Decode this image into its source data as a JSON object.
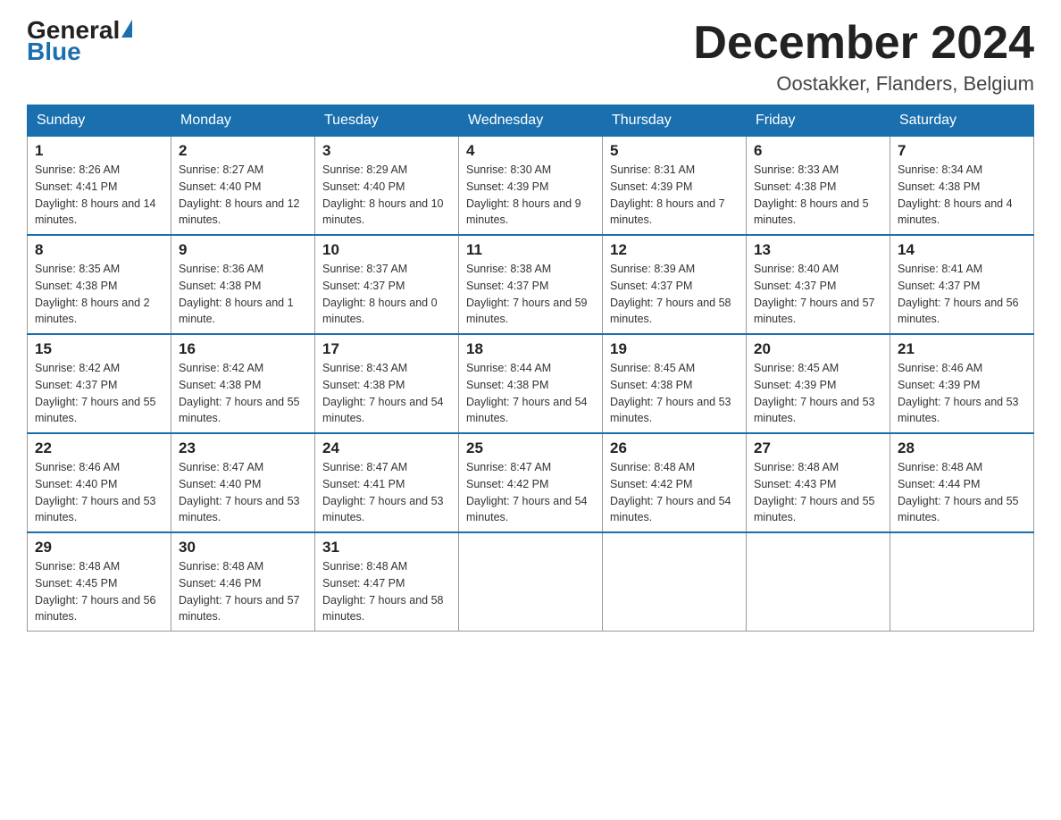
{
  "logo": {
    "general": "General",
    "blue": "Blue"
  },
  "header": {
    "title": "December 2024",
    "subtitle": "Oostakker, Flanders, Belgium"
  },
  "columns": [
    "Sunday",
    "Monday",
    "Tuesday",
    "Wednesday",
    "Thursday",
    "Friday",
    "Saturday"
  ],
  "weeks": [
    [
      {
        "day": "1",
        "sunrise": "8:26 AM",
        "sunset": "4:41 PM",
        "daylight": "8 hours and 14 minutes."
      },
      {
        "day": "2",
        "sunrise": "8:27 AM",
        "sunset": "4:40 PM",
        "daylight": "8 hours and 12 minutes."
      },
      {
        "day": "3",
        "sunrise": "8:29 AM",
        "sunset": "4:40 PM",
        "daylight": "8 hours and 10 minutes."
      },
      {
        "day": "4",
        "sunrise": "8:30 AM",
        "sunset": "4:39 PM",
        "daylight": "8 hours and 9 minutes."
      },
      {
        "day": "5",
        "sunrise": "8:31 AM",
        "sunset": "4:39 PM",
        "daylight": "8 hours and 7 minutes."
      },
      {
        "day": "6",
        "sunrise": "8:33 AM",
        "sunset": "4:38 PM",
        "daylight": "8 hours and 5 minutes."
      },
      {
        "day": "7",
        "sunrise": "8:34 AM",
        "sunset": "4:38 PM",
        "daylight": "8 hours and 4 minutes."
      }
    ],
    [
      {
        "day": "8",
        "sunrise": "8:35 AM",
        "sunset": "4:38 PM",
        "daylight": "8 hours and 2 minutes."
      },
      {
        "day": "9",
        "sunrise": "8:36 AM",
        "sunset": "4:38 PM",
        "daylight": "8 hours and 1 minute."
      },
      {
        "day": "10",
        "sunrise": "8:37 AM",
        "sunset": "4:37 PM",
        "daylight": "8 hours and 0 minutes."
      },
      {
        "day": "11",
        "sunrise": "8:38 AM",
        "sunset": "4:37 PM",
        "daylight": "7 hours and 59 minutes."
      },
      {
        "day": "12",
        "sunrise": "8:39 AM",
        "sunset": "4:37 PM",
        "daylight": "7 hours and 58 minutes."
      },
      {
        "day": "13",
        "sunrise": "8:40 AM",
        "sunset": "4:37 PM",
        "daylight": "7 hours and 57 minutes."
      },
      {
        "day": "14",
        "sunrise": "8:41 AM",
        "sunset": "4:37 PM",
        "daylight": "7 hours and 56 minutes."
      }
    ],
    [
      {
        "day": "15",
        "sunrise": "8:42 AM",
        "sunset": "4:37 PM",
        "daylight": "7 hours and 55 minutes."
      },
      {
        "day": "16",
        "sunrise": "8:42 AM",
        "sunset": "4:38 PM",
        "daylight": "7 hours and 55 minutes."
      },
      {
        "day": "17",
        "sunrise": "8:43 AM",
        "sunset": "4:38 PM",
        "daylight": "7 hours and 54 minutes."
      },
      {
        "day": "18",
        "sunrise": "8:44 AM",
        "sunset": "4:38 PM",
        "daylight": "7 hours and 54 minutes."
      },
      {
        "day": "19",
        "sunrise": "8:45 AM",
        "sunset": "4:38 PM",
        "daylight": "7 hours and 53 minutes."
      },
      {
        "day": "20",
        "sunrise": "8:45 AM",
        "sunset": "4:39 PM",
        "daylight": "7 hours and 53 minutes."
      },
      {
        "day": "21",
        "sunrise": "8:46 AM",
        "sunset": "4:39 PM",
        "daylight": "7 hours and 53 minutes."
      }
    ],
    [
      {
        "day": "22",
        "sunrise": "8:46 AM",
        "sunset": "4:40 PM",
        "daylight": "7 hours and 53 minutes."
      },
      {
        "day": "23",
        "sunrise": "8:47 AM",
        "sunset": "4:40 PM",
        "daylight": "7 hours and 53 minutes."
      },
      {
        "day": "24",
        "sunrise": "8:47 AM",
        "sunset": "4:41 PM",
        "daylight": "7 hours and 53 minutes."
      },
      {
        "day": "25",
        "sunrise": "8:47 AM",
        "sunset": "4:42 PM",
        "daylight": "7 hours and 54 minutes."
      },
      {
        "day": "26",
        "sunrise": "8:48 AM",
        "sunset": "4:42 PM",
        "daylight": "7 hours and 54 minutes."
      },
      {
        "day": "27",
        "sunrise": "8:48 AM",
        "sunset": "4:43 PM",
        "daylight": "7 hours and 55 minutes."
      },
      {
        "day": "28",
        "sunrise": "8:48 AM",
        "sunset": "4:44 PM",
        "daylight": "7 hours and 55 minutes."
      }
    ],
    [
      {
        "day": "29",
        "sunrise": "8:48 AM",
        "sunset": "4:45 PM",
        "daylight": "7 hours and 56 minutes."
      },
      {
        "day": "30",
        "sunrise": "8:48 AM",
        "sunset": "4:46 PM",
        "daylight": "7 hours and 57 minutes."
      },
      {
        "day": "31",
        "sunrise": "8:48 AM",
        "sunset": "4:47 PM",
        "daylight": "7 hours and 58 minutes."
      },
      null,
      null,
      null,
      null
    ]
  ]
}
